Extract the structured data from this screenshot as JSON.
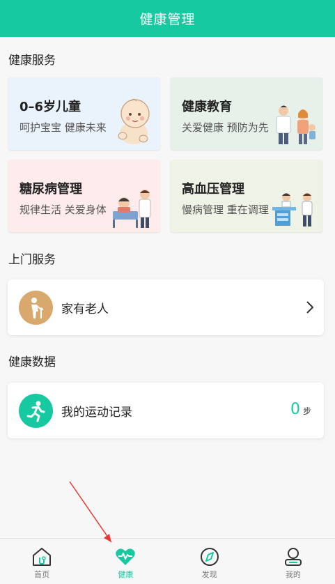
{
  "header": {
    "title": "健康管理"
  },
  "sections": {
    "health_services": "健康服务",
    "home_services": "上门服务",
    "health_data": "健康数据"
  },
  "service_cards": [
    {
      "title": "0–6岁儿童",
      "subtitle": "呵护宝宝 健康未来",
      "icon": "baby-icon",
      "bg": "#eaf2fb"
    },
    {
      "title": "健康教育",
      "subtitle": "关爱健康 预防为先",
      "icon": "doctor-family-icon",
      "bg": "#e7f1ea"
    },
    {
      "title": "糖尿病管理",
      "subtitle": "规律生活 关爱身体",
      "icon": "patient-doctor-icon",
      "bg": "#fdeceb"
    },
    {
      "title": "高血压管理",
      "subtitle": "慢病管理 重在调理",
      "icon": "consultation-icon",
      "bg": "#eff2e6"
    }
  ],
  "home_service": {
    "label": "家有老人",
    "icon": "elderly-icon",
    "icon_bg": "#d9a86c"
  },
  "exercise": {
    "label": "我的运动记录",
    "icon": "running-icon",
    "icon_bg": "#16c9a1",
    "steps": "0",
    "unit": "步"
  },
  "tabbar": [
    {
      "label": "首页",
      "icon": "home-icon",
      "active": false
    },
    {
      "label": "健康",
      "icon": "heart-pulse-icon",
      "active": true
    },
    {
      "label": "发现",
      "icon": "compass-icon",
      "active": false
    },
    {
      "label": "我的",
      "icon": "profile-icon",
      "active": false
    }
  ],
  "colors": {
    "accent": "#16c9a1",
    "annotation_arrow": "#e53935"
  }
}
